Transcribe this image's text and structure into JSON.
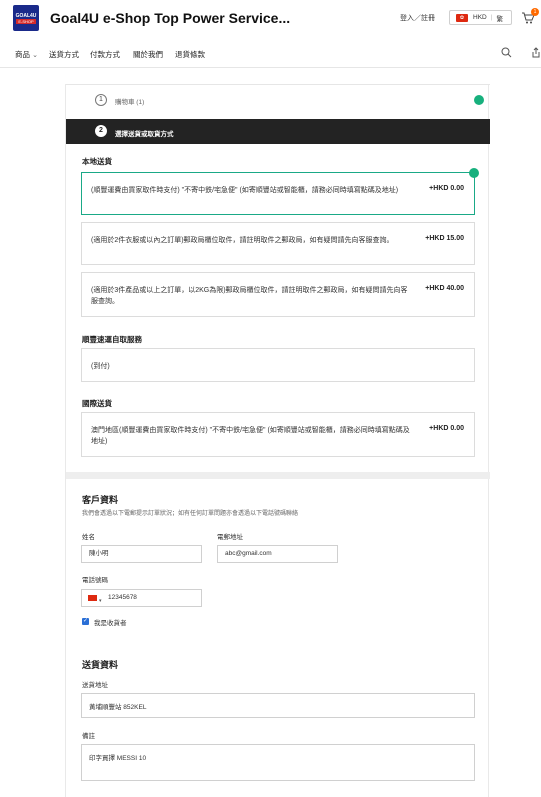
{
  "header": {
    "logo_line1": "GOAL4U",
    "logo_line2": "E-SHOP",
    "title": "Goal4U e-Shop Top Power Service...",
    "login": "登入／註冊",
    "currency": "HKD",
    "language": "繁",
    "cart_count": "1",
    "flag_color": "#de2910"
  },
  "nav": {
    "items": [
      {
        "label": "商品",
        "has_dropdown": true
      },
      {
        "label": "送貨方式"
      },
      {
        "label": "付款方式"
      },
      {
        "label": "關於我們"
      },
      {
        "label": "退貨條款"
      }
    ],
    "dropdown_glyph": "⌄"
  },
  "checkout": {
    "step1": {
      "num": "1",
      "label": "購物車 (1)"
    },
    "step2": {
      "num": "2",
      "label": "選擇送貨或取貨方式"
    },
    "accent_color": "#17b07d",
    "local": {
      "title": "本地送貨",
      "options": [
        {
          "desc": "(順豐運費由買家取件時支付) \"不寄中鉄/宅急便\" (如寄順豐站或智能櫃，請務必同時填寫點碼及地址)",
          "price": "+HKD 0.00",
          "selected": true
        },
        {
          "desc": "(適用於2件衣服或以內之訂單)郵政局櫃位取件，請註明取件之郵政局，如有疑問請先向客服查詢。",
          "price": "+HKD 15.00",
          "selected": false
        },
        {
          "desc": "(適用於3件產品或以上之訂單，以2KG為限)郵政局櫃位取件，請註明取件之郵政局，如有疑問請先向客服查詢。",
          "price": "+HKD 40.00",
          "selected": false
        }
      ]
    },
    "sf_pickup": {
      "title": "順豐速運自取服務",
      "options": [
        {
          "desc": "(到付)",
          "price": "",
          "selected": false
        }
      ]
    },
    "international": {
      "title": "國際送貨",
      "options": [
        {
          "desc": "澳門地區(順豐運費由買家取件時支付) \"不寄中鉄/宅急便\" (如寄順豐站或智能櫃，請務必同時填寫點碼及地址)",
          "price": "+HKD 0.00",
          "selected": false
        }
      ]
    },
    "customer": {
      "title": "客戶資料",
      "hint": "我們會透過以下電郵提示訂單狀況；如有任何訂單問題亦會透過以下電話號碼聯絡",
      "name_label": "姓名",
      "name_value": "陳小明",
      "email_label": "電郵地址",
      "email_value": "abc@gmail.com",
      "phone_label": "電話號碼",
      "phone_value": "12345678",
      "recipient_checkbox": "我是收貨者",
      "recipient_checked": true
    },
    "delivery": {
      "title": "送貨資料",
      "address_label": "送貨地址",
      "address_value": "黃埔順豐站 852KEL",
      "note_label": "備註",
      "note_value": "印字買擇 MESSI 10"
    }
  }
}
